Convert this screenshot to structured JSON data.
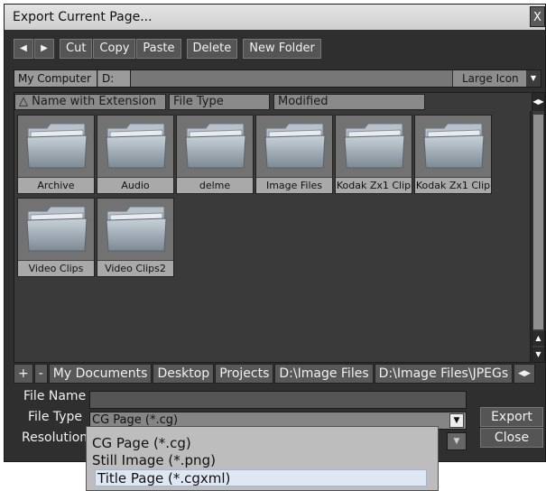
{
  "window": {
    "title": "Export Current Page...",
    "close_label": "X"
  },
  "toolbar": {
    "back_icon": "◀",
    "forward_icon": "▶",
    "cut": "Cut",
    "copy": "Copy",
    "paste": "Paste",
    "delete": "Delete",
    "new_folder": "New Folder"
  },
  "path": {
    "root": "My Computer",
    "drive": "D:",
    "view_mode": "Large Icon"
  },
  "columns": {
    "name": "Name with Extension",
    "type": "File Type",
    "modified": "Modified"
  },
  "files": [
    {
      "name": "Archive"
    },
    {
      "name": "Audio"
    },
    {
      "name": "delme"
    },
    {
      "name": "Image Files"
    },
    {
      "name": "Kodak Zx1 Clip"
    },
    {
      "name": "Kodak Zx1 Clip"
    },
    {
      "name": "Video Clips"
    },
    {
      "name": "Video Clips2"
    }
  ],
  "favorites": {
    "add": "+",
    "remove": "-",
    "items": [
      "My Documents",
      "Desktop",
      "Projects",
      "D:\\Image Files",
      "D:\\Image Files\\JPEGs"
    ]
  },
  "form": {
    "file_name_label": "File Name",
    "file_name_value": "",
    "file_type_label": "File Type",
    "file_type_value": "CG Page (*.cg)",
    "resolution_label": "Resolution",
    "export": "Export",
    "close": "Close"
  },
  "file_type_options": [
    "CG Page (*.cg)",
    "Still Image (*.png)",
    "Title Page (*.cgxml)"
  ],
  "file_type_highlighted": "Title Page (*.cgxml)"
}
